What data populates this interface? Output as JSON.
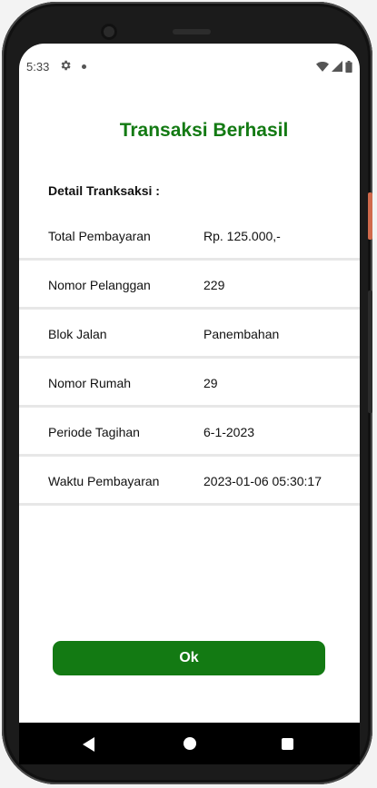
{
  "status_bar": {
    "time": "5:33"
  },
  "screen": {
    "title": "Transaksi Berhasil",
    "detail_label": "Detail Tranksaksi :",
    "rows": [
      {
        "label": "Total Pembayaran",
        "value": "Rp. 125.000,-"
      },
      {
        "label": "Nomor Pelanggan",
        "value": "229"
      },
      {
        "label": "Blok Jalan",
        "value": "Panembahan"
      },
      {
        "label": "Nomor Rumah",
        "value": "29"
      },
      {
        "label": "Periode Tagihan",
        "value": "6-1-2023"
      },
      {
        "label": "Waktu Pembayaran",
        "value": "2023-01-06 05:30:17"
      }
    ],
    "ok_button_label": "Ok"
  },
  "colors": {
    "accent": "#137a13",
    "divider": "#e7e7e7"
  },
  "icons": {
    "status": [
      "gear-icon",
      "notification-dot-icon",
      "wifi-icon",
      "signal-icon",
      "battery-icon"
    ],
    "navigation": [
      "back-icon",
      "home-icon",
      "recent-apps-icon"
    ]
  }
}
